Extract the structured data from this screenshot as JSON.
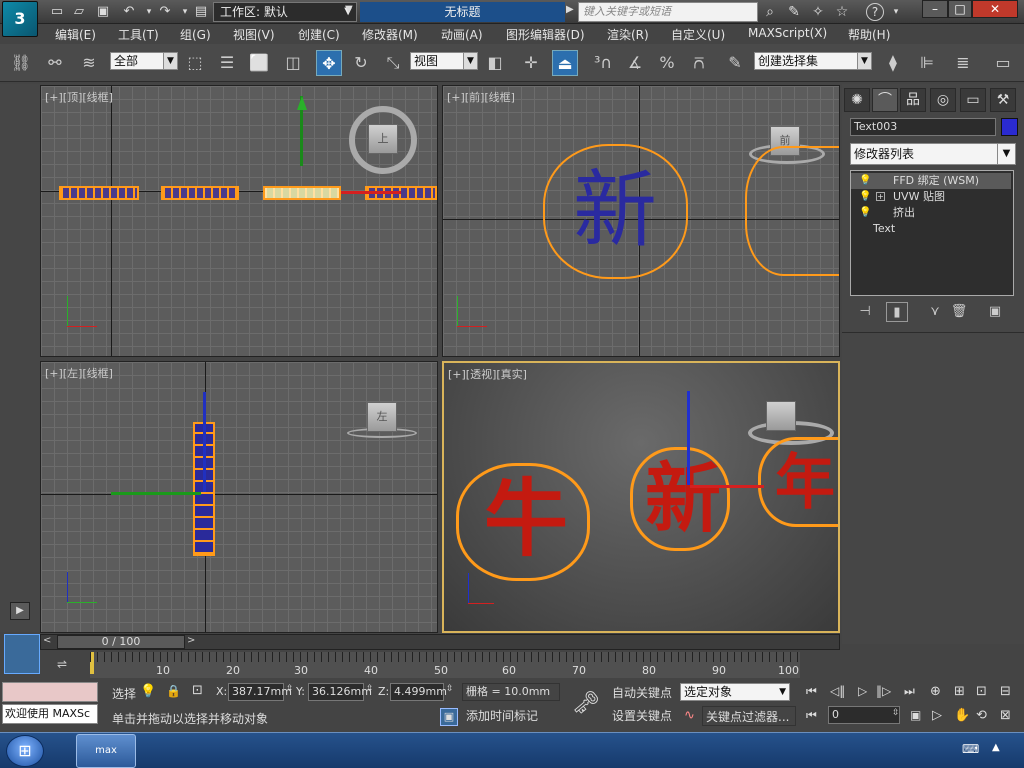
{
  "titlebar": {
    "app_logo": "3ds Max",
    "workspace_label": "工作区: 默认",
    "title": "无标题",
    "search_placeholder": "键入关键字或短语",
    "minimize": "–",
    "maximize": "□",
    "close": "✕"
  },
  "menu": [
    "编辑(E)",
    "工具(T)",
    "组(G)",
    "视图(V)",
    "创建(C)",
    "修改器(M)",
    "动画(A)",
    "图形编辑器(D)",
    "渲染(R)",
    "自定义(U)",
    "MAXScript(X)",
    "帮助(H)"
  ],
  "toolbar": {
    "selection_filter": "全部",
    "ref_coord": "视图",
    "named_selection": "创建选择集"
  },
  "viewports": {
    "top": "[+][顶][线框]",
    "front": "[+][前][线框]",
    "left": "[+][左][线框]",
    "persp": "[+][透视][真实]",
    "cube_top": "上",
    "cube_front": "前",
    "cube_left": "左"
  },
  "command_panel": {
    "object_name": "Text003",
    "object_color": "#2a2ad0",
    "modifier_list": "修改器列表",
    "stack": [
      {
        "label": "FFD 绑定 (WSM)",
        "has_plus": false
      },
      {
        "label": "UVW 贴图",
        "has_plus": true
      },
      {
        "label": "挤出",
        "has_plus": false
      },
      {
        "label": "Text",
        "has_plus": false
      }
    ]
  },
  "timeline": {
    "frame_counter": "0 / 100",
    "ticks": [
      "10",
      "20",
      "30",
      "40",
      "50",
      "60",
      "70",
      "80",
      "90",
      "100"
    ]
  },
  "status": {
    "welcome": "欢迎使用 MAXSc",
    "select_label": "选择",
    "x_label": "X:",
    "x_value": "387.17mm",
    "y_label": "Y:",
    "y_value": "36.126mm",
    "z_label": "Z:",
    "z_value": "4.499mm",
    "grid": "栅格 = 10.0mm",
    "prompt": "单击并拖动以选择并移动对象",
    "add_time_tag": "添加时间标记",
    "auto_key": "自动关键点",
    "set_key": "设置关键点",
    "key_mode_select": "选定对象",
    "key_filters": "关键点过滤器...",
    "current_frame": "0"
  },
  "taskbar": {
    "start": "⊞",
    "app_label": "max"
  }
}
